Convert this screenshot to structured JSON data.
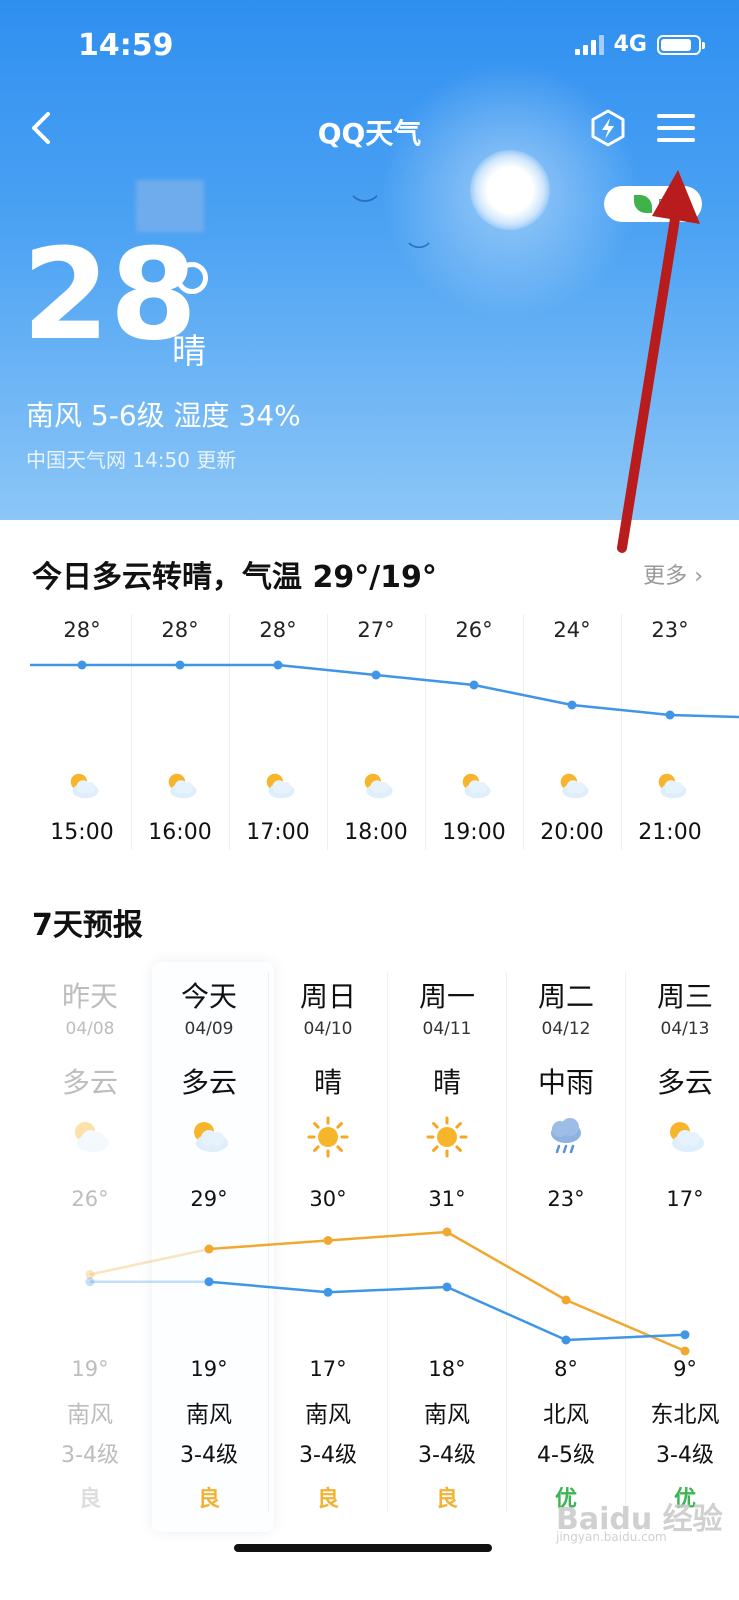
{
  "status": {
    "time": "14:59",
    "network": "4G"
  },
  "header": {
    "title": "QQ天气",
    "aqi_badge": "良"
  },
  "current": {
    "temp": "28",
    "condition": "晴",
    "wind_humidity": "南风 5-6级  湿度 34%",
    "source": "中国天气网   14:50 更新"
  },
  "today": {
    "title": "今日多云转晴，气温 29°/19°",
    "more": "更多",
    "hours": [
      {
        "temp": "28°",
        "time": "15:00",
        "value": 28.0
      },
      {
        "temp": "28°",
        "time": "16:00",
        "value": 28.0
      },
      {
        "temp": "28°",
        "time": "17:00",
        "value": 28.0
      },
      {
        "temp": "27°",
        "time": "18:00",
        "value": 27.0
      },
      {
        "temp": "26°",
        "time": "19:00",
        "value": 26.0
      },
      {
        "temp": "24°",
        "time": "20:00",
        "value": 24.0
      },
      {
        "temp": "23°",
        "time": "21:00",
        "value": 23.0
      }
    ]
  },
  "forecast": {
    "title": "7天预报",
    "days": [
      {
        "name": "昨天",
        "date": "04/08",
        "cond": "多云",
        "icon": "partly-cloudy-icon",
        "hi": "26°",
        "lo": "19°",
        "hi_v": 26,
        "lo_v": 19,
        "wind": "南风",
        "level": "3-4级",
        "aqi": "良",
        "aqi_color": "#f2b233",
        "dim": true
      },
      {
        "name": "今天",
        "date": "04/09",
        "cond": "多云",
        "icon": "partly-cloudy-icon",
        "hi": "29°",
        "lo": "19°",
        "hi_v": 29,
        "lo_v": 19,
        "wind": "南风",
        "level": "3-4级",
        "aqi": "良",
        "aqi_color": "#f2b233",
        "dim": false
      },
      {
        "name": "周日",
        "date": "04/10",
        "cond": "晴",
        "icon": "sun-icon",
        "hi": "30°",
        "lo": "17°",
        "hi_v": 30,
        "lo_v": 17,
        "wind": "南风",
        "level": "3-4级",
        "aqi": "良",
        "aqi_color": "#f2b233",
        "dim": false
      },
      {
        "name": "周一",
        "date": "04/11",
        "cond": "晴",
        "icon": "sun-icon",
        "hi": "31°",
        "lo": "18°",
        "hi_v": 31,
        "lo_v": 18,
        "wind": "南风",
        "level": "3-4级",
        "aqi": "良",
        "aqi_color": "#f2b233",
        "dim": false
      },
      {
        "name": "周二",
        "date": "04/12",
        "cond": "中雨",
        "icon": "rain-cloud-icon",
        "hi": "23°",
        "lo": "8°",
        "hi_v": 23,
        "lo_v": 8,
        "wind": "北风",
        "level": "4-5级",
        "aqi": "优",
        "aqi_color": "#3cb454",
        "dim": false
      },
      {
        "name": "周三",
        "date": "04/13",
        "cond": "多云",
        "icon": "partly-cloudy-icon",
        "hi": "17°",
        "lo": "9°",
        "hi_v": 17,
        "lo_v": 9,
        "wind": "东北风",
        "level": "3-4级",
        "aqi": "优",
        "aqi_color": "#3cb454",
        "dim": false
      }
    ]
  },
  "watermark": {
    "brand": "Baidu 经验",
    "url": "jingyan.baidu.com"
  },
  "colors": {
    "high_line": "#f0a830",
    "low_line": "#3f95e6",
    "hour_line": "#3f95e6"
  }
}
